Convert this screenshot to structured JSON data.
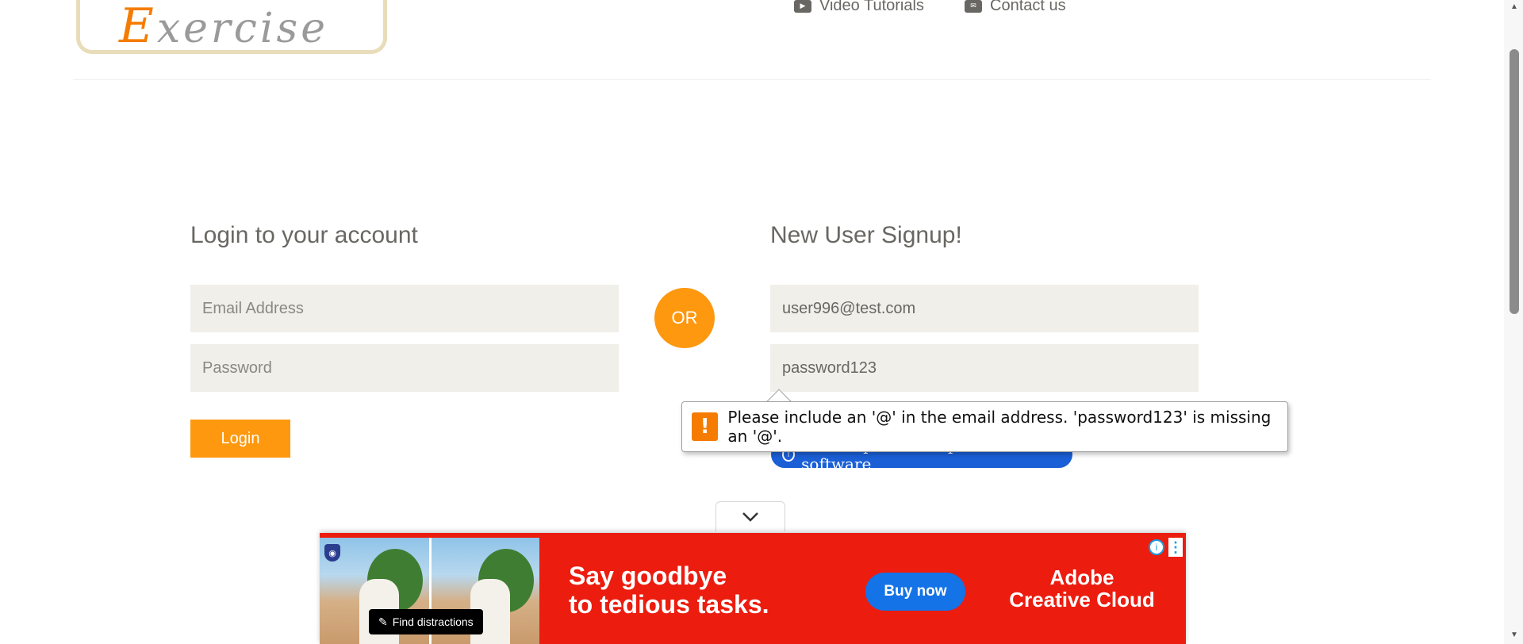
{
  "header": {
    "logo_first_letter": "E",
    "logo_rest": "xercise",
    "nav": [
      {
        "label": "Video Tutorials",
        "icon": "youtube-play-icon"
      },
      {
        "label": "Contact us",
        "icon": "envelope-icon"
      }
    ]
  },
  "login": {
    "title": "Login to your account",
    "email_placeholder": "Email Address",
    "password_placeholder": "Password",
    "button": "Login"
  },
  "or_label": "OR",
  "signup": {
    "title": "New User Signup!",
    "name_value": "user996@test.com",
    "email_value": "password123",
    "hidden_pill_text": "User experience optimization software"
  },
  "validation": {
    "message": "Please include an '@' in the email address. 'password123' is missing an '@'.",
    "icon": "!"
  },
  "ad": {
    "find_label": "Find distractions",
    "headline_line1": "Say goodbye",
    "headline_line2": "to tedious tasks.",
    "button": "Buy now",
    "brand_line1": "Adobe",
    "brand_line2": "Creative Cloud",
    "info_icon": "i",
    "more_icon": "⋮"
  },
  "colors": {
    "accent": "#fe980f",
    "input_bg": "#f0efe9",
    "ad_red": "#ec1c0f",
    "ad_blue": "#1473e6"
  }
}
